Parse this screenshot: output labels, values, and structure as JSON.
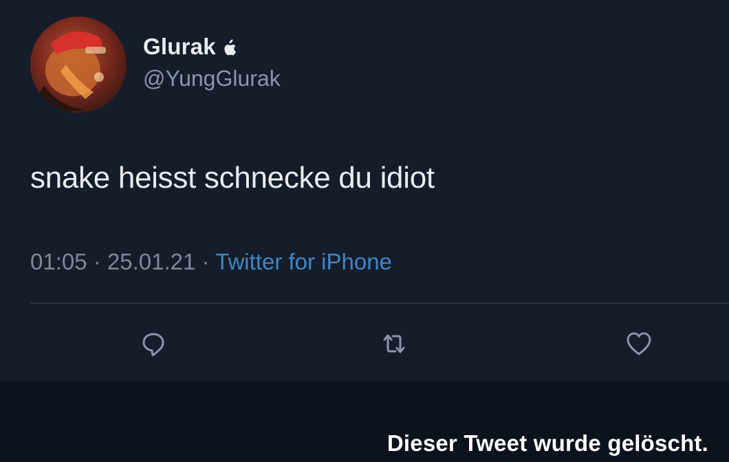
{
  "user": {
    "display_name": "Glurak",
    "handle": "@YungGlurak",
    "avatar": "avatar-image",
    "badge_icon": "apple-icon"
  },
  "tweet": {
    "text": "snake heisst schnecke du idiot",
    "time": "01:05",
    "separator": " · ",
    "date": "25.01.21",
    "source": "Twitter for iPhone"
  },
  "actions": [
    {
      "name": "reply",
      "icon": "speech-bubble-icon"
    },
    {
      "name": "retweet",
      "icon": "retweet-arrows-icon"
    },
    {
      "name": "like",
      "icon": "heart-icon"
    }
  ],
  "banner": {
    "text": "Dieser Tweet wurde gelöscht."
  },
  "colors": {
    "background": "#151d2a",
    "banner_background": "#0d131c",
    "primary_text": "#e9edf2",
    "secondary_text": "#7e8998",
    "link": "#3f86c8"
  }
}
